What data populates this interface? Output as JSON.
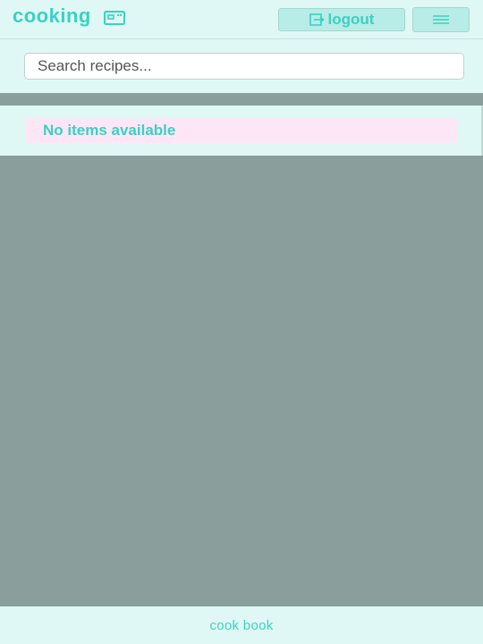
{
  "header": {
    "title": "cooking",
    "title_icon": "oven-icon",
    "logout_label": "logout",
    "logout_icon": "logout-icon",
    "menu_icon": "hamburger-menu-icon"
  },
  "search": {
    "placeholder": "Search recipes...",
    "value": ""
  },
  "list": {
    "empty_message": "No items available",
    "items": []
  },
  "footer": {
    "text": "cook book"
  },
  "colors": {
    "accent": "#3bd1c2",
    "panel_bg": "#dff8f5",
    "backdrop": "#8a9f9c",
    "button_bg": "#b8ece6",
    "empty_bg": "#fde7f7"
  }
}
